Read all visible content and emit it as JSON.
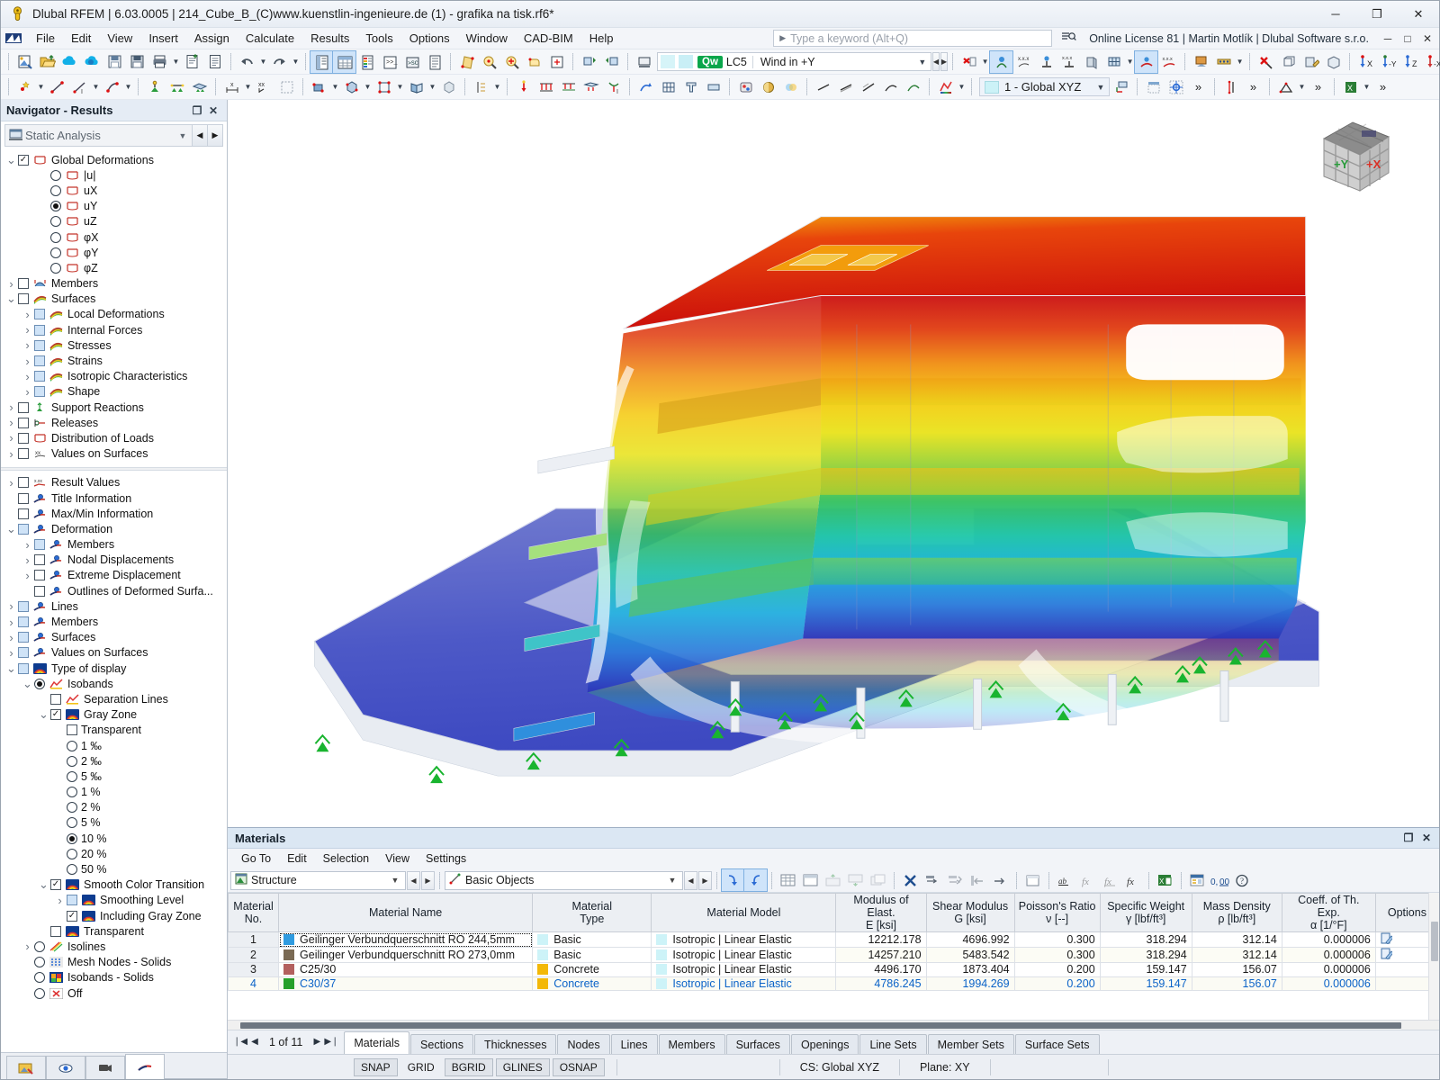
{
  "window": {
    "title": "Dlubal RFEM | 6.03.0005 | 214_Cube_B_(C)www.kuenstlin-ingenieure.de (1) - grafika na tisk.rf6*",
    "minimize": "─",
    "maximize": "❐",
    "close": "✕"
  },
  "menubar": {
    "items": [
      "File",
      "Edit",
      "View",
      "Insert",
      "Assign",
      "Calculate",
      "Results",
      "Tools",
      "Options",
      "Window",
      "CAD-BIM",
      "Help"
    ],
    "search_placeholder": "Type a keyword (Alt+Q)",
    "license": "Online License 81 | Martin Motlík | Dlubal Software s.r.o.",
    "mini_minimize": "─",
    "mini_restore": "□",
    "mini_close": "✕"
  },
  "loadcase": {
    "qw": "Qw",
    "number": "LC5",
    "name": "Wind in +Y"
  },
  "coordsystem": {
    "value": "1 - Global XYZ"
  },
  "navigator": {
    "title": "Navigator - Results",
    "undock": "❐",
    "close": "✕",
    "selector": "Static Analysis",
    "tree_top": [
      {
        "label": "Global Deformations",
        "indent": 0,
        "exp": "v",
        "ctrl": "check",
        "state": "checked",
        "icon": "deform"
      },
      {
        "label": "|u|",
        "indent": 2,
        "exp": "",
        "ctrl": "radio",
        "state": "",
        "icon": "deform"
      },
      {
        "label": "uX",
        "indent": 2,
        "exp": "",
        "ctrl": "radio",
        "state": "",
        "icon": "deform"
      },
      {
        "label": "uY",
        "indent": 2,
        "exp": "",
        "ctrl": "radio",
        "state": "on",
        "icon": "deform"
      },
      {
        "label": "uZ",
        "indent": 2,
        "exp": "",
        "ctrl": "radio",
        "state": "",
        "icon": "deform"
      },
      {
        "label": "φX",
        "indent": 2,
        "exp": "",
        "ctrl": "radio",
        "state": "",
        "icon": "deform"
      },
      {
        "label": "φY",
        "indent": 2,
        "exp": "",
        "ctrl": "radio",
        "state": "",
        "icon": "deform"
      },
      {
        "label": "φZ",
        "indent": 2,
        "exp": "",
        "ctrl": "radio",
        "state": "",
        "icon": "deform"
      },
      {
        "label": "Members",
        "indent": 0,
        "exp": ">",
        "ctrl": "check",
        "state": "",
        "icon": "member"
      },
      {
        "label": "Surfaces",
        "indent": 0,
        "exp": "v",
        "ctrl": "check",
        "state": "",
        "icon": "rainbow"
      },
      {
        "label": "Local Deformations",
        "indent": 1,
        "exp": ">",
        "ctrl": "check",
        "state": "blue",
        "icon": "rainbow"
      },
      {
        "label": "Internal Forces",
        "indent": 1,
        "exp": ">",
        "ctrl": "check",
        "state": "blue",
        "icon": "rainbow"
      },
      {
        "label": "Stresses",
        "indent": 1,
        "exp": ">",
        "ctrl": "check",
        "state": "blue",
        "icon": "rainbow"
      },
      {
        "label": "Strains",
        "indent": 1,
        "exp": ">",
        "ctrl": "check",
        "state": "blue",
        "icon": "rainbow"
      },
      {
        "label": "Isotropic Characteristics",
        "indent": 1,
        "exp": ">",
        "ctrl": "check",
        "state": "blue",
        "icon": "rainbow"
      },
      {
        "label": "Shape",
        "indent": 1,
        "exp": ">",
        "ctrl": "check",
        "state": "blue",
        "icon": "rainbow"
      },
      {
        "label": "Support Reactions",
        "indent": 0,
        "exp": ">",
        "ctrl": "check",
        "state": "",
        "icon": "support"
      },
      {
        "label": "Releases",
        "indent": 0,
        "exp": ">",
        "ctrl": "check",
        "state": "",
        "icon": "release"
      },
      {
        "label": "Distribution of Loads",
        "indent": 0,
        "exp": ">",
        "ctrl": "check",
        "state": "",
        "icon": "deform"
      },
      {
        "label": "Values on Surfaces",
        "indent": 0,
        "exp": ">",
        "ctrl": "check",
        "state": "",
        "icon": "values"
      }
    ],
    "tree_bottom": [
      {
        "label": "Result Values",
        "indent": 0,
        "exp": ">",
        "ctrl": "check",
        "state": "",
        "icon": "resval"
      },
      {
        "label": "Title Information",
        "indent": 0,
        "exp": "",
        "ctrl": "check",
        "state": "",
        "icon": "eye"
      },
      {
        "label": "Max/Min Information",
        "indent": 0,
        "exp": "",
        "ctrl": "check",
        "state": "",
        "icon": "eye"
      },
      {
        "label": "Deformation",
        "indent": 0,
        "exp": "v",
        "ctrl": "check",
        "state": "blue",
        "icon": "eye"
      },
      {
        "label": "Members",
        "indent": 1,
        "exp": ">",
        "ctrl": "check",
        "state": "blue",
        "icon": "eye"
      },
      {
        "label": "Nodal Displacements",
        "indent": 1,
        "exp": ">",
        "ctrl": "check",
        "state": "",
        "icon": "eye"
      },
      {
        "label": "Extreme Displacement",
        "indent": 1,
        "exp": ">",
        "ctrl": "check",
        "state": "",
        "icon": "eye"
      },
      {
        "label": "Outlines of Deformed Surfa...",
        "indent": 1,
        "exp": "",
        "ctrl": "check",
        "state": "",
        "icon": "eye"
      },
      {
        "label": "Lines",
        "indent": 0,
        "exp": ">",
        "ctrl": "check",
        "state": "blue",
        "icon": "eye"
      },
      {
        "label": "Members",
        "indent": 0,
        "exp": ">",
        "ctrl": "check",
        "state": "blue",
        "icon": "eye"
      },
      {
        "label": "Surfaces",
        "indent": 0,
        "exp": ">",
        "ctrl": "check",
        "state": "blue",
        "icon": "eye"
      },
      {
        "label": "Values on Surfaces",
        "indent": 0,
        "exp": ">",
        "ctrl": "check",
        "state": "blue",
        "icon": "eye"
      },
      {
        "label": "Type of display",
        "indent": 0,
        "exp": "v",
        "ctrl": "check",
        "state": "blue",
        "icon": "rainbow2"
      },
      {
        "label": "Isobands",
        "indent": 1,
        "exp": "v",
        "ctrl": "radio",
        "state": "on",
        "icon": "isoband"
      },
      {
        "label": "Separation Lines",
        "indent": 2,
        "exp": "",
        "ctrl": "check",
        "state": "",
        "icon": "isoband"
      },
      {
        "label": "Gray Zone",
        "indent": 2,
        "exp": "v",
        "ctrl": "check",
        "state": "checked",
        "icon": "rainbow2"
      },
      {
        "label": "Transparent",
        "indent": 3,
        "exp": "",
        "ctrl": "check",
        "state": "",
        "icon": "none"
      },
      {
        "label": "1 ‰",
        "indent": 3,
        "exp": "",
        "ctrl": "radio",
        "state": "",
        "icon": "none"
      },
      {
        "label": "2 ‰",
        "indent": 3,
        "exp": "",
        "ctrl": "radio",
        "state": "",
        "icon": "none"
      },
      {
        "label": "5 ‰",
        "indent": 3,
        "exp": "",
        "ctrl": "radio",
        "state": "",
        "icon": "none"
      },
      {
        "label": "1 %",
        "indent": 3,
        "exp": "",
        "ctrl": "radio",
        "state": "",
        "icon": "none"
      },
      {
        "label": "2 %",
        "indent": 3,
        "exp": "",
        "ctrl": "radio",
        "state": "",
        "icon": "none"
      },
      {
        "label": "5 %",
        "indent": 3,
        "exp": "",
        "ctrl": "radio",
        "state": "",
        "icon": "none"
      },
      {
        "label": "10 %",
        "indent": 3,
        "exp": "",
        "ctrl": "radio",
        "state": "on",
        "icon": "none"
      },
      {
        "label": "20 %",
        "indent": 3,
        "exp": "",
        "ctrl": "radio",
        "state": "",
        "icon": "none"
      },
      {
        "label": "50 %",
        "indent": 3,
        "exp": "",
        "ctrl": "radio",
        "state": "",
        "icon": "none"
      },
      {
        "label": "Smooth Color Transition",
        "indent": 2,
        "exp": "v",
        "ctrl": "check",
        "state": "checked",
        "icon": "rainbow2"
      },
      {
        "label": "Smoothing Level",
        "indent": 3,
        "exp": ">",
        "ctrl": "check",
        "state": "blue",
        "icon": "rainbow2"
      },
      {
        "label": "Including Gray Zone",
        "indent": 3,
        "exp": "",
        "ctrl": "check",
        "state": "checked",
        "icon": "rainbow2"
      },
      {
        "label": "Transparent",
        "indent": 2,
        "exp": "",
        "ctrl": "check",
        "state": "",
        "icon": "rainbow2"
      },
      {
        "label": "Isolines",
        "indent": 1,
        "exp": ">",
        "ctrl": "radio",
        "state": "",
        "icon": "isoline"
      },
      {
        "label": "Mesh Nodes - Solids",
        "indent": 1,
        "exp": "",
        "ctrl": "radio",
        "state": "",
        "icon": "mesh"
      },
      {
        "label": "Isobands - Solids",
        "indent": 1,
        "exp": "",
        "ctrl": "radio",
        "state": "",
        "icon": "isosolid"
      },
      {
        "label": "Off",
        "indent": 1,
        "exp": "",
        "ctrl": "radio",
        "state": "",
        "icon": "off"
      }
    ],
    "bottom_tabs": [
      "project-navigator-icon",
      "display-navigator-icon",
      "views-navigator-icon",
      "results-navigator-icon"
    ]
  },
  "dock": {
    "title": "Materials",
    "undock": "❐",
    "close": "✕",
    "menu": [
      "Go To",
      "Edit",
      "Selection",
      "View",
      "Settings"
    ],
    "scope": "Structure",
    "objects": "Basic Objects"
  },
  "table": {
    "headers": [
      {
        "l1": "Material",
        "l2": "No."
      },
      {
        "l1": "Material Name",
        "l2": ""
      },
      {
        "l1": "Material",
        "l2": "Type"
      },
      {
        "l1": "Material Model",
        "l2": ""
      },
      {
        "l1": "Modulus of Elast.",
        "l2": "E [ksi]"
      },
      {
        "l1": "Shear Modulus",
        "l2": "G [ksi]"
      },
      {
        "l1": "Poisson's Ratio",
        "l2": "ν [--]"
      },
      {
        "l1": "Specific Weight",
        "l2": "γ [lbf/ft³]"
      },
      {
        "l1": "Mass Density",
        "l2": "ρ [lb/ft³]"
      },
      {
        "l1": "Coeff. of Th. Exp.",
        "l2": "α [1/°F]"
      },
      {
        "l1": "Options",
        "l2": ""
      }
    ],
    "rows": [
      {
        "no": "1",
        "name": "Geilinger Verbundquerschnitt RO 244,5mm",
        "name_color": "#2f9be0",
        "type": "Basic",
        "type_color": "#cdf3f8",
        "model": "Isotropic | Linear Elastic",
        "E": "12212.178",
        "G": "4696.992",
        "nu": "0.300",
        "gamma": "318.294",
        "rho": "312.14",
        "alpha": "0.000006",
        "opt": "edit-icon",
        "active": true,
        "sel": false
      },
      {
        "no": "2",
        "name": "Geilinger Verbundquerschnitt RO 273,0mm",
        "name_color": "#7a6a54",
        "type": "Basic",
        "type_color": "#cdf3f8",
        "model": "Isotropic | Linear Elastic",
        "E": "14257.210",
        "G": "5483.542",
        "nu": "0.300",
        "gamma": "318.294",
        "rho": "312.14",
        "alpha": "0.000006",
        "opt": "edit-icon",
        "active": false,
        "sel": false
      },
      {
        "no": "3",
        "name": "C25/30",
        "name_color": "#b3605f",
        "type": "Concrete",
        "type_color": "#f3b808",
        "model": "Isotropic | Linear Elastic",
        "E": "4496.170",
        "G": "1873.404",
        "nu": "0.200",
        "gamma": "159.147",
        "rho": "156.07",
        "alpha": "0.000006",
        "opt": "",
        "active": false,
        "sel": false
      },
      {
        "no": "4",
        "name": "C30/37",
        "name_color": "#27a02c",
        "type": "Concrete",
        "type_color": "#f3b808",
        "model": "Isotropic | Linear Elastic",
        "E": "4786.245",
        "G": "1994.269",
        "nu": "0.200",
        "gamma": "159.147",
        "rho": "156.07",
        "alpha": "0.000006",
        "opt": "",
        "active": false,
        "sel": true
      }
    ]
  },
  "tabs": {
    "pager_first": "❘◀",
    "pager_prev": "◀",
    "page_label": "1 of 11",
    "pager_next": "▶",
    "pager_last": "▶❘",
    "items": [
      "Materials",
      "Sections",
      "Thicknesses",
      "Nodes",
      "Lines",
      "Members",
      "Surfaces",
      "Openings",
      "Line Sets",
      "Member Sets",
      "Surface Sets"
    ],
    "active": "Materials"
  },
  "status": {
    "toggles": [
      {
        "label": "SNAP",
        "on": true
      },
      {
        "label": "GRID",
        "on": false
      },
      {
        "label": "BGRID",
        "on": true
      },
      {
        "label": "GLINES",
        "on": true
      },
      {
        "label": "OSNAP",
        "on": true
      }
    ],
    "cs": "CS: Global XYZ",
    "plane": "Plane: XY"
  },
  "viewcube": {
    "label_x": "+X",
    "label_y": "+Y"
  },
  "viewport": {
    "result_type": "uY",
    "colorscale": [
      "#c90b0b",
      "#e8490d",
      "#f5a70c",
      "#ffe300",
      "#9fd330",
      "#2fbf54",
      "#17c3a5",
      "#17b7e0",
      "#2e7fdd",
      "#2b3fc0"
    ]
  }
}
